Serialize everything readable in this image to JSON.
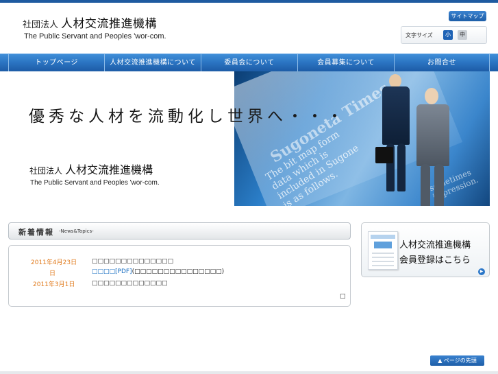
{
  "header": {
    "org_prefix": "社団法人",
    "org_name": "人材交流推進機構",
    "org_name_en": "The Public Servant and Peoples 'wor-com.",
    "sitemap_label": "サイトマップ",
    "font_size_label": "文字サイズ",
    "font_size_small": "小",
    "font_size_medium": "中"
  },
  "nav": {
    "items": [
      {
        "label": "トップページ"
      },
      {
        "label": "人材交流推進機構について"
      },
      {
        "label": "委員会について"
      },
      {
        "label": "会員募集について"
      },
      {
        "label": "お問合せ"
      }
    ]
  },
  "hero": {
    "tagline": "優秀な人材を流動化し世界へ・・・",
    "org_prefix": "社団法人",
    "org_name": "人材交流推進機構",
    "org_name_en": "The Public Servant and Peoples 'wor-com.",
    "paper_headline": "Sugoneta Times",
    "paper_text": "The bit map form\ndata which is\nincluded in Sugone\nis as follows.",
    "paper_text2": "sometimes\nimpression."
  },
  "news": {
    "title": "新着情報",
    "subtitle": "-News&Topics-",
    "items": [
      {
        "date": "2011年4月23日",
        "text": "□□□□□□□□□□□□□□"
      },
      {
        "date": "日",
        "link": "□□□□[PDF]",
        "text": "(□□□□□□□□□□□□□□□)"
      },
      {
        "date": "2011年3月1日",
        "text": "□□□□□□□□□□□□□"
      }
    ],
    "end_mark": "□"
  },
  "side_banner": {
    "line1": "人材交流推進機構",
    "line2": "会員登録はこちら",
    "arrow": "▶"
  },
  "footer": {
    "pagetop_label": "▲ ページの先頭"
  }
}
